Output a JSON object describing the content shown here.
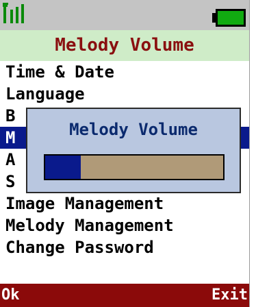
{
  "status": {
    "signal_icon": "signal-strength-icon",
    "battery_icon": "battery-full-icon",
    "colors": {
      "signal": "#0a8a0a",
      "battery": "#11aa11"
    }
  },
  "title": "Melody Volume",
  "menu": {
    "items": [
      {
        "label": "Time & Date"
      },
      {
        "label": "Language"
      },
      {
        "label": "B"
      },
      {
        "label": "M"
      },
      {
        "label": "A"
      },
      {
        "label": "S"
      },
      {
        "label": "Image Management"
      },
      {
        "label": "Melody Management"
      },
      {
        "label": "Change Password"
      }
    ],
    "selected_index": 3
  },
  "dialog": {
    "title": "Melody Volume",
    "volume_level": 0.2
  },
  "softkeys": {
    "left": "Ok",
    "right": "Exit"
  },
  "colors": {
    "title_bg": "#cfecc8",
    "title_text": "#8a1010",
    "selection": "#0a1a8c",
    "dialog_bg": "#b9c7e0",
    "softkey_bg": "#8b0a0a"
  }
}
